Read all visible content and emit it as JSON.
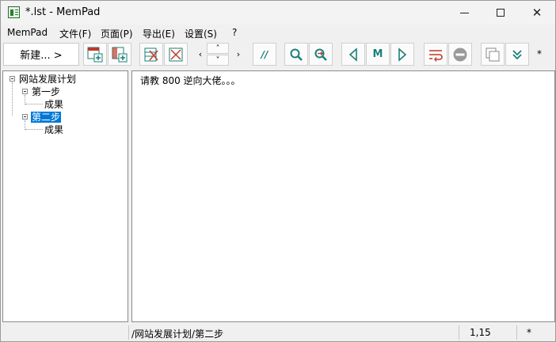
{
  "window": {
    "title": "*.lst - MemPad"
  },
  "menu": [
    "MemPad",
    "文件(F)",
    "页面(P)",
    "导出(E)",
    "设置(S)",
    "?"
  ],
  "toolbar": {
    "new_label": "新建... >",
    "star": "*",
    "buttons": [
      "add-page-icon",
      "add-subpage-icon",
      "delete-page-icon",
      "cut-page-icon",
      "move-left-icon",
      "move-up-icon",
      "move-down-icon",
      "move-right-icon",
      "comment-icon",
      "find-icon",
      "find-replace-icon",
      "prev-icon",
      "mark-icon",
      "next-icon",
      "wrap-icon",
      "stop-icon",
      "window-icon",
      "expand-icon"
    ],
    "m_label": "M",
    "comment_label": "//"
  },
  "tree": {
    "root": "网站发展计划",
    "children": [
      {
        "label": "第一步",
        "children": [
          "成果"
        ]
      },
      {
        "label": "第二步",
        "children": [
          "成果"
        ],
        "selected": true
      }
    ]
  },
  "editor": {
    "content": "请教 800 逆向大佬。。。"
  },
  "status": {
    "path": "/网站发展计划/第二步",
    "position": "1,15",
    "modified": "*"
  },
  "colors": {
    "accent": "#0078d7",
    "icon_teal": "#1a7f7a",
    "icon_red": "#c0392b"
  }
}
